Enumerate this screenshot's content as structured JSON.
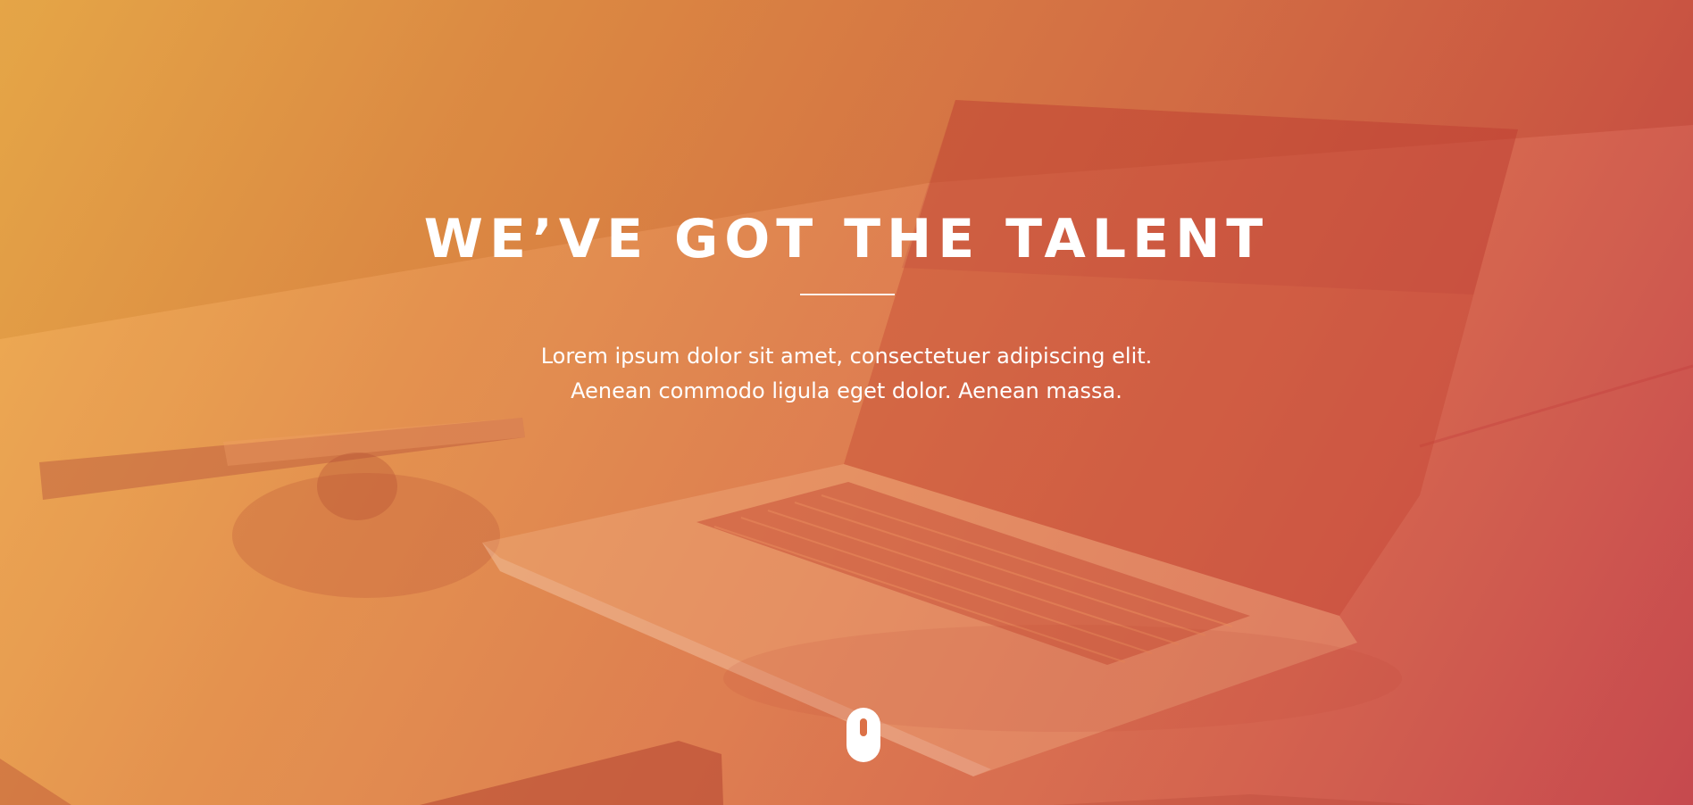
{
  "hero": {
    "headline": "WE’VE GOT THE TALENT",
    "subtext_line1": "Lorem ipsum dolor sit amet, consectetuer adipiscing elit.",
    "subtext_line2": "Aenean commodo ligula eget dolor. Aenean massa.",
    "scroll_icon": "mouse-scroll-icon"
  },
  "colors": {
    "gradient_start": "#eeac4a",
    "gradient_mid": "#dc7647",
    "gradient_end": "#c33e43",
    "text": "#ffffff"
  }
}
